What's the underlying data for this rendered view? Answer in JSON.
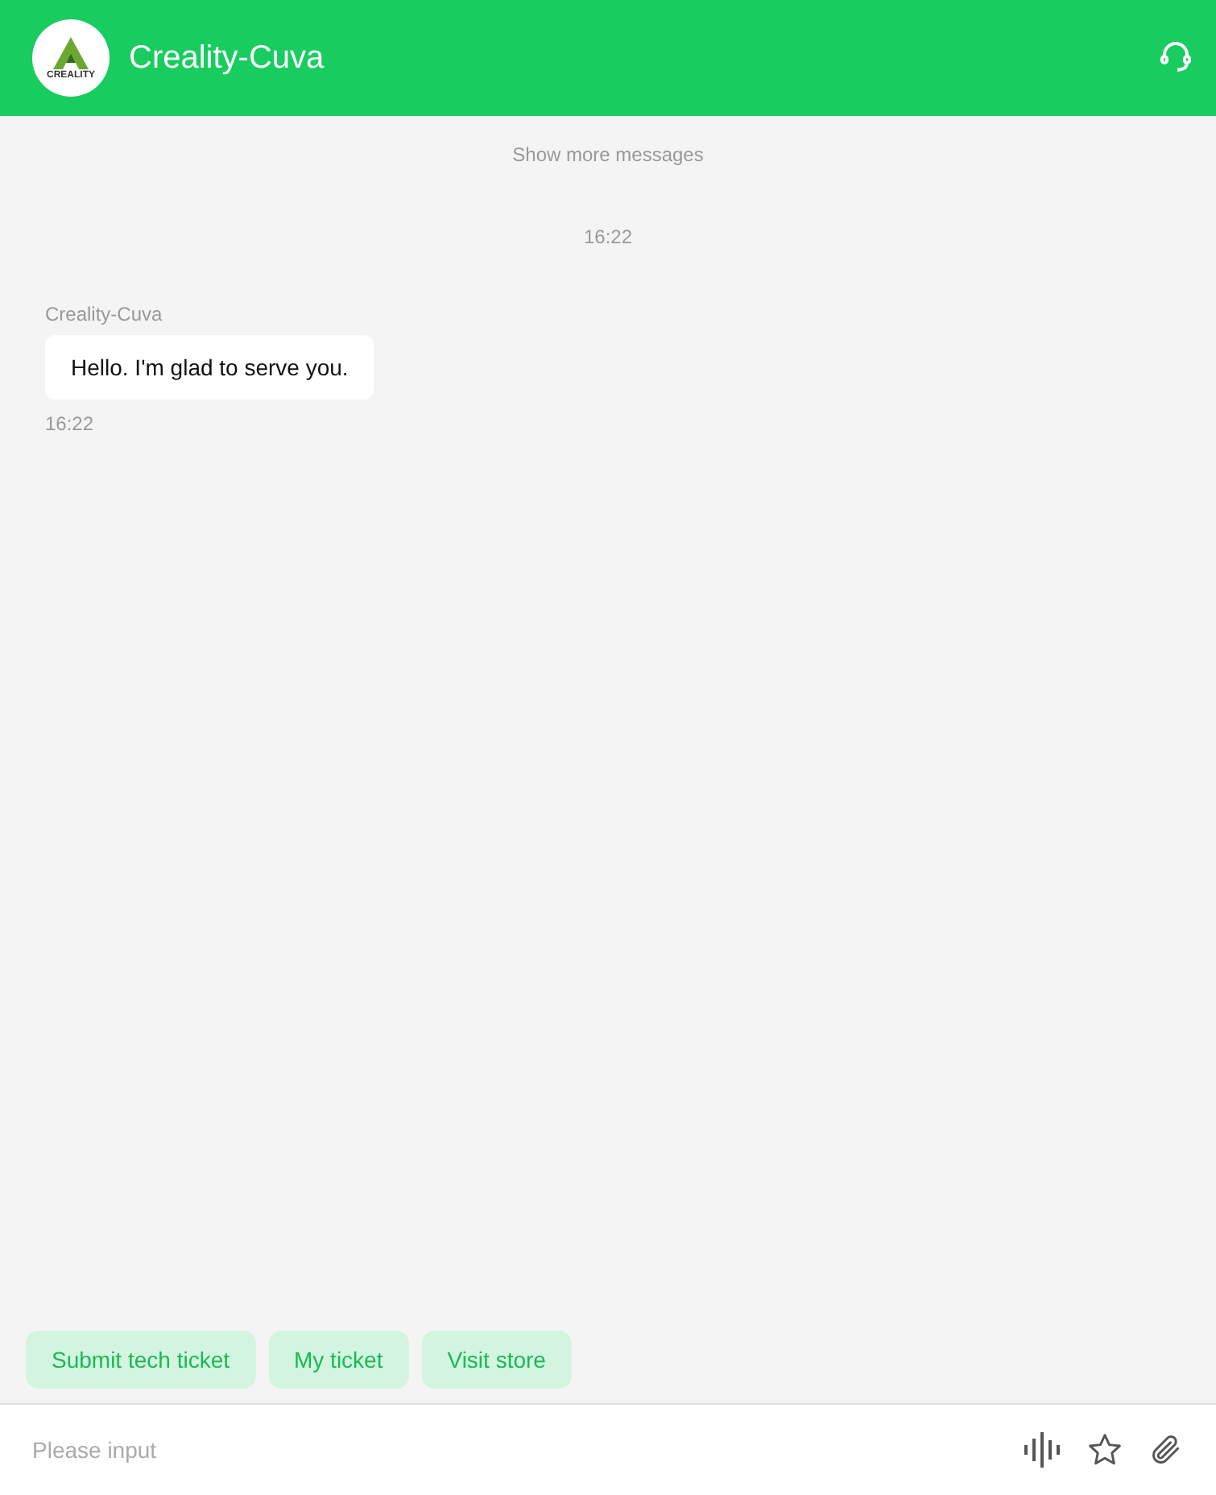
{
  "header": {
    "logo_text": "CREALITY",
    "title": "Creality-Cuva"
  },
  "chat": {
    "show_more": "Show more messages",
    "timestamp": "16:22",
    "messages": [
      {
        "sender": "Creality-Cuva",
        "text": "Hello. I'm glad to serve you.",
        "time": "16:22"
      }
    ]
  },
  "quick_actions": [
    "Submit tech ticket",
    "My ticket",
    "Visit store"
  ],
  "input": {
    "placeholder": "Please input"
  }
}
